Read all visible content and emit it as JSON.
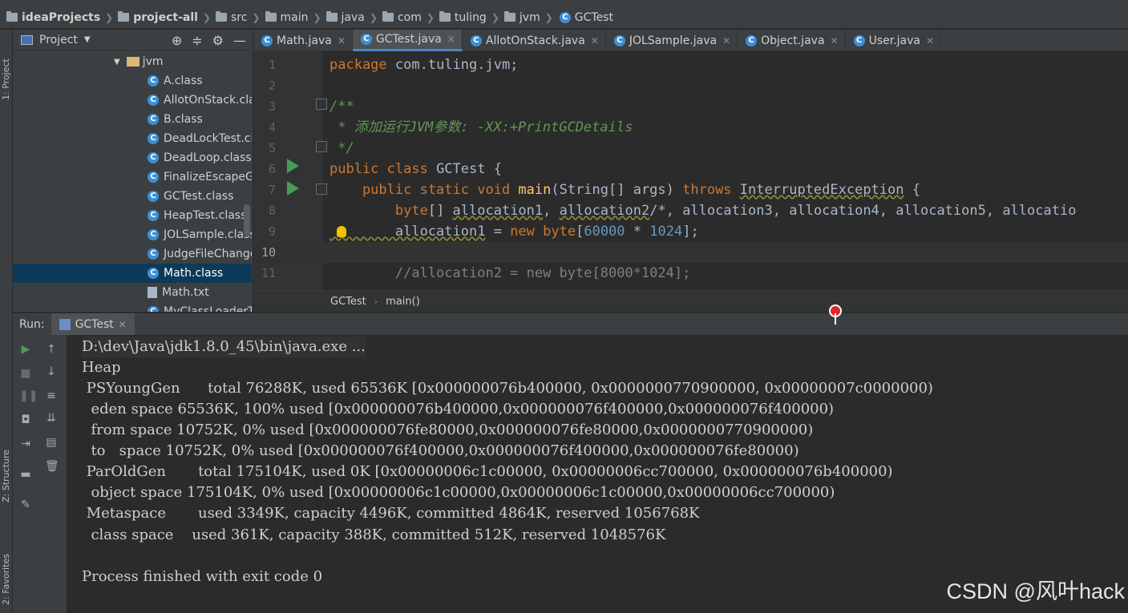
{
  "breadcrumb": [
    "ideaProjects",
    "project-all",
    "src",
    "main",
    "java",
    "com",
    "tuling",
    "jvm",
    "GCTest"
  ],
  "left_strip": {
    "project_label": "1: Project",
    "structure_label": "Z: Structure",
    "favorites_label": "2: Favorites"
  },
  "project_panel": {
    "title": "Project",
    "tree": [
      {
        "label": "jvm",
        "kind": "dir"
      },
      {
        "label": "A.class",
        "kind": "class"
      },
      {
        "label": "AllotOnStack.clas",
        "kind": "class"
      },
      {
        "label": "B.class",
        "kind": "class"
      },
      {
        "label": "DeadLockTest.cl",
        "kind": "class"
      },
      {
        "label": "DeadLoop.class",
        "kind": "class"
      },
      {
        "label": "FinalizeEscapeGC",
        "kind": "class"
      },
      {
        "label": "GCTest.class",
        "kind": "class"
      },
      {
        "label": "HeapTest.class",
        "kind": "class"
      },
      {
        "label": "JOLSample.class",
        "kind": "class"
      },
      {
        "label": "JudgeFileChange",
        "kind": "class"
      },
      {
        "label": "Math.class",
        "kind": "class",
        "selected": true
      },
      {
        "label": "Math.txt",
        "kind": "file"
      },
      {
        "label": "MyClassLoaderT",
        "kind": "class"
      }
    ]
  },
  "tabs": [
    {
      "label": "Math.java",
      "active": false
    },
    {
      "label": "GCTest.java",
      "active": true
    },
    {
      "label": "AllotOnStack.java",
      "active": false
    },
    {
      "label": "JOLSample.java",
      "active": false
    },
    {
      "label": "Object.java",
      "active": false
    },
    {
      "label": "User.java",
      "active": false
    }
  ],
  "editor": {
    "line_numbers": [
      "1",
      "2",
      "3",
      "4",
      "5",
      "6",
      "7",
      "8",
      "9",
      "10",
      "11"
    ],
    "code": {
      "l1_kw": "package",
      "l1_rest": " com.tuling.jvm;",
      "l3": "/**",
      "l4": " * 添加运行JVM参数: -XX:+PrintGCDetails",
      "l5": " */",
      "l6_kw": "public class",
      "l6_rest": " GCTest {",
      "l7_kw": "    public static void",
      "l7_fn": " main",
      "l7_args": "(String[] args) ",
      "l7_throws": "throws",
      "l7_exc": "InterruptedException",
      "l7_end": " {",
      "l8_kw": "        byte",
      "l8_rest1": "[] ",
      "l8_var1": "allocation1",
      "l8_rest2": ", ",
      "l8_var2": "allocation2",
      "l8_cm": "/*, allocation3, allocation4, allocation5, allocatio",
      "l9_var": "        allocation1",
      "l9_rest1": " = ",
      "l9_kw1": "new",
      "l9_kw2": " byte",
      "l9_rest2": "[",
      "l9_n1": "60000",
      "l9_rest3": " * ",
      "l9_n2": "1024",
      "l9_rest4": "];",
      "l11": "        //allocation2 = new byte[8000*1024];"
    },
    "breadcrumb": [
      "GCTest",
      "main()"
    ]
  },
  "run": {
    "label": "Run:",
    "tab": "GCTest",
    "console": [
      "D:\\dev\\Java\\jdk1.8.0_45\\bin\\java.exe ...",
      "Heap",
      " PSYoungGen      total 76288K, used 65536K [0x000000076b400000, 0x0000000770900000, 0x00000007c0000000)",
      "  eden space 65536K, 100% used [0x000000076b400000,0x000000076f400000,0x000000076f400000)",
      "  from space 10752K, 0% used [0x000000076fe80000,0x000000076fe80000,0x0000000770900000)",
      "  to   space 10752K, 0% used [0x000000076f400000,0x000000076f400000,0x000000076fe80000)",
      " ParOldGen       total 175104K, used 0K [0x00000006c1c00000, 0x00000006cc700000, 0x000000076b400000)",
      "  object space 175104K, 0% used [0x00000006c1c00000,0x00000006c1c00000,0x00000006cc700000)",
      " Metaspace       used 3349K, capacity 4496K, committed 4864K, reserved 1056768K",
      "  class space    used 361K, capacity 388K, committed 512K, reserved 1048576K",
      "",
      "Process finished with exit code 0"
    ]
  },
  "watermark": "CSDN @风叶hack",
  "colors": {
    "keyword": "#cc7832",
    "comment": "#808080",
    "doc_comment": "#629755",
    "number": "#6897bb",
    "function": "#ffc66d",
    "selection": "#0d3a58",
    "accent": "#4a88c7"
  }
}
